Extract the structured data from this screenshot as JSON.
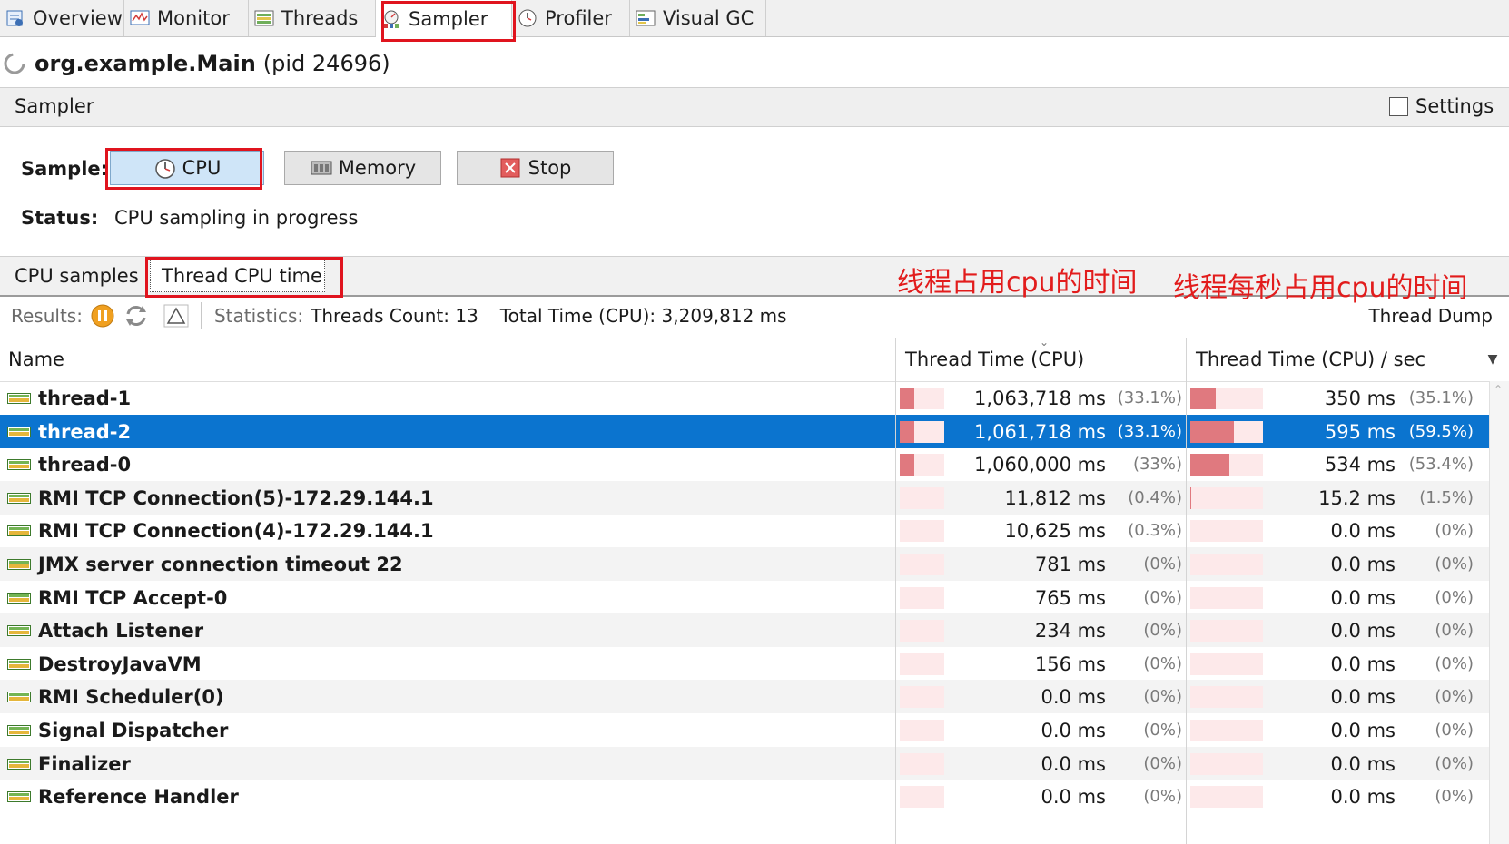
{
  "tabs": [
    {
      "label": "Overview",
      "icon": "overview-icon"
    },
    {
      "label": "Monitor",
      "icon": "monitor-icon"
    },
    {
      "label": "Threads",
      "icon": "threads-icon"
    },
    {
      "label": "Sampler",
      "icon": "sampler-icon",
      "active": true
    },
    {
      "label": "Profiler",
      "icon": "profiler-icon"
    },
    {
      "label": "Visual GC",
      "icon": "visual-gc-icon"
    }
  ],
  "app": {
    "main_class": "org.example.Main",
    "pid": "(pid 24696)"
  },
  "sampler": {
    "section_title": "Sampler",
    "settings_label": "Settings"
  },
  "sample": {
    "label": "Sample:",
    "cpu": "CPU",
    "memory": "Memory",
    "stop": "Stop"
  },
  "status": {
    "label": "Status:",
    "value": "CPU sampling in progress"
  },
  "subtabs": {
    "cpu_samples": "CPU samples",
    "thread_cpu_time": "Thread CPU time"
  },
  "annotations": {
    "left": "线程占用cpu的时间",
    "right": "线程每秒占用cpu的时间"
  },
  "results": {
    "label": "Results:",
    "statistics_label": "Statistics:",
    "threads_count": "Threads Count: 13",
    "total_time": "Total Time (CPU): 3,209,812 ms",
    "thread_dump": "Thread Dump"
  },
  "columns": {
    "name": "Name",
    "cpu": "Thread Time (CPU)",
    "cpu_sec": "Thread Time (CPU) / sec"
  },
  "rows": [
    {
      "name": "thread-1",
      "cpu": "1,063,718 ms",
      "cpu_pct": "(33.1%)",
      "cpu_frac": 0.331,
      "sec": "350 ms",
      "sec_pct": "(35.1%)",
      "sec_frac": 0.351
    },
    {
      "name": "thread-2",
      "cpu": "1,061,718 ms",
      "cpu_pct": "(33.1%)",
      "cpu_frac": 0.331,
      "sec": "595 ms",
      "sec_pct": "(59.5%)",
      "sec_frac": 0.595,
      "selected": true
    },
    {
      "name": "thread-0",
      "cpu": "1,060,000 ms",
      "cpu_pct": "(33%)",
      "cpu_frac": 0.33,
      "sec": "534 ms",
      "sec_pct": "(53.4%)",
      "sec_frac": 0.534
    },
    {
      "name": "RMI TCP Connection(5)-172.29.144.1",
      "cpu": "11,812 ms",
      "cpu_pct": "(0.4%)",
      "cpu_frac": 0.004,
      "sec": "15.2 ms",
      "sec_pct": "(1.5%)",
      "sec_frac": 0.015
    },
    {
      "name": "RMI TCP Connection(4)-172.29.144.1",
      "cpu": "10,625 ms",
      "cpu_pct": "(0.3%)",
      "cpu_frac": 0.003,
      "sec": "0.0 ms",
      "sec_pct": "(0%)",
      "sec_frac": 0
    },
    {
      "name": "JMX server connection timeout 22",
      "cpu": "781 ms",
      "cpu_pct": "(0%)",
      "cpu_frac": 0,
      "sec": "0.0 ms",
      "sec_pct": "(0%)",
      "sec_frac": 0
    },
    {
      "name": "RMI TCP Accept-0",
      "cpu": "765 ms",
      "cpu_pct": "(0%)",
      "cpu_frac": 0,
      "sec": "0.0 ms",
      "sec_pct": "(0%)",
      "sec_frac": 0
    },
    {
      "name": "Attach Listener",
      "cpu": "234 ms",
      "cpu_pct": "(0%)",
      "cpu_frac": 0,
      "sec": "0.0 ms",
      "sec_pct": "(0%)",
      "sec_frac": 0
    },
    {
      "name": "DestroyJavaVM",
      "cpu": "156 ms",
      "cpu_pct": "(0%)",
      "cpu_frac": 0,
      "sec": "0.0 ms",
      "sec_pct": "(0%)",
      "sec_frac": 0
    },
    {
      "name": "RMI Scheduler(0)",
      "cpu": "0.0 ms",
      "cpu_pct": "(0%)",
      "cpu_frac": 0,
      "sec": "0.0 ms",
      "sec_pct": "(0%)",
      "sec_frac": 0
    },
    {
      "name": "Signal Dispatcher",
      "cpu": "0.0 ms",
      "cpu_pct": "(0%)",
      "cpu_frac": 0,
      "sec": "0.0 ms",
      "sec_pct": "(0%)",
      "sec_frac": 0
    },
    {
      "name": "Finalizer",
      "cpu": "0.0 ms",
      "cpu_pct": "(0%)",
      "cpu_frac": 0,
      "sec": "0.0 ms",
      "sec_pct": "(0%)",
      "sec_frac": 0
    },
    {
      "name": "Reference Handler",
      "cpu": "0.0 ms",
      "cpu_pct": "(0%)",
      "cpu_frac": 0,
      "sec": "0.0 ms",
      "sec_pct": "(0%)",
      "sec_frac": 0
    }
  ],
  "colors": {
    "selection": "#0b74cf",
    "bar_fill": "#e0797f",
    "bar_bg": "#fde9ea",
    "highlight_box": "#e0141e",
    "annotation_text": "#e21c1c"
  }
}
